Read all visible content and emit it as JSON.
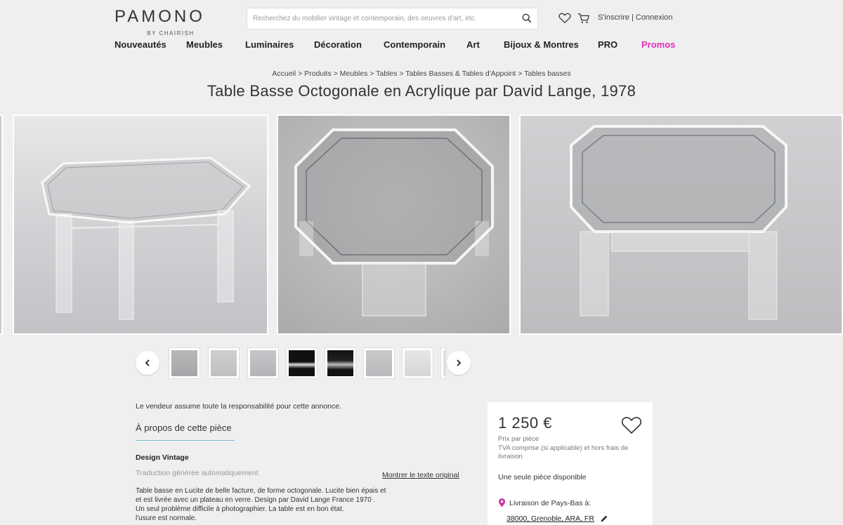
{
  "header": {
    "logo_text": "PAMONO",
    "logo_sub": "BY CHAIRISH",
    "search_placeholder": "Recherchez du mobilier vintage et contemporain, des oeuvres d'art, etc.",
    "signup": "S'inscrire",
    "separator": "|",
    "login": "Connexion"
  },
  "nav": [
    "Nouveautés",
    "Meubles",
    "Luminaires",
    "Décoration",
    "Contemporain",
    "Art",
    "Bijoux & Montres",
    "PRO",
    "Promos"
  ],
  "breadcrumb": "Accueil > Produits > Meubles > Tables > Tables Basses & Tables d'Appoint > Tables basses",
  "product": {
    "title": "Table Basse Octogonale en Acrylique par David Lange, 1978",
    "responsibility": "Le vendeur assume toute la responsabilité pour cette annonce.",
    "about_tab": "À propos de cette pièce",
    "design_label": "Design Vintage",
    "translation_note": "Traduction générée automatiquement",
    "show_original": "Montrer le texte original",
    "description": [
      "Table basse en Lucite de belle facture, de forme octogonale. Lucite bien épais et",
      "et est livrée avec un plateau en verre. Design par David Lange France 1970 .",
      "Un seul problème difficile à photographier. La table est en bon état.",
      "l'usure est normale."
    ]
  },
  "purchase": {
    "price": "1 250 €",
    "price_note": "Prix par pièce",
    "tax_note": "TVA comprise (si applicable) et hors frais de livraison",
    "availability": "Une seule pièce disponible",
    "delivery_label": "Livraison de Pays-Bas à:",
    "location": "38000, Grenoble, ARA, FR"
  },
  "colors": {
    "accent_promo": "#e02fb8",
    "underline": "#7fb6d4",
    "location_pin": "#d0309e"
  }
}
